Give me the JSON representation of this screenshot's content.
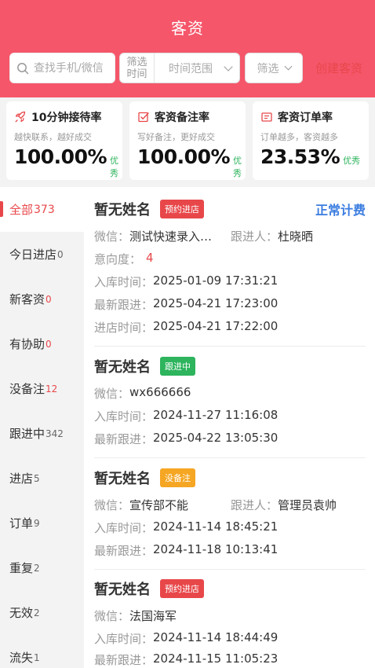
{
  "header": {
    "title": "客资"
  },
  "search": {
    "placeholder": "查找手机/微信"
  },
  "time_filter": {
    "label_line1": "筛选",
    "label_line2": "时间",
    "value": "时间范围"
  },
  "filter": {
    "label": "筛选"
  },
  "create": {
    "label": "创建客资"
  },
  "stats": [
    {
      "title": "10分钟接待率",
      "sub": "越快联系，越好成交",
      "value": "100.00%",
      "badge": "优秀",
      "icon": "rocket-icon"
    },
    {
      "title": "客资备注率",
      "sub": "写好备注，更好成交",
      "value": "100.00%",
      "badge": "优秀",
      "icon": "checkbox-icon"
    },
    {
      "title": "客资订单率",
      "sub": "订单越多，客资越多",
      "value": "23.53%",
      "badge": "优秀",
      "icon": "order-icon"
    }
  ],
  "sidebar": [
    {
      "label": "全部",
      "count": "373"
    },
    {
      "label": "今日进店",
      "count": "0"
    },
    {
      "label": "新客资",
      "count": "0"
    },
    {
      "label": "有协助",
      "count": "0"
    },
    {
      "label": "没备注",
      "count": "12"
    },
    {
      "label": "跟进中",
      "count": "342"
    },
    {
      "label": "进店",
      "count": "5"
    },
    {
      "label": "订单",
      "count": "9"
    },
    {
      "label": "重复",
      "count": "2"
    },
    {
      "label": "无效",
      "count": "2"
    },
    {
      "label": "流失",
      "count": "1"
    }
  ],
  "cards": [
    {
      "name": "暂无姓名",
      "tag": "预约进店",
      "tag_color": "#e8474a",
      "billing": "正常计费",
      "wechat_label": "微信：",
      "wechat": "测试快速录入…",
      "follower_label": "跟进人：",
      "follower": "杜晓晒",
      "intent_label": "意向度：",
      "intent": "4",
      "in_label": "入库时间：",
      "in_time": "2025-01-09 17:31:21",
      "latest_label": "最新跟进：",
      "latest_time": "2025-04-21 17:23:00",
      "store_label": "进店时间：",
      "store_time": "2025-04-21 17:22:00"
    },
    {
      "name": "暂无姓名",
      "tag": "跟进中",
      "tag_color": "#2db45d",
      "wechat_label": "微信：",
      "wechat": "wx666666",
      "in_label": "入库时间：",
      "in_time": "2024-11-27 11:16:08",
      "latest_label": "最新跟进：",
      "latest_time": "2025-04-22 13:05:30"
    },
    {
      "name": "暂无姓名",
      "tag": "没备注",
      "tag_color": "#f5a623",
      "wechat_label": "微信：",
      "wechat": "宣传部不能",
      "follower_label": "跟进人：",
      "follower": "管理员袁帅",
      "in_label": "入库时间：",
      "in_time": "2024-11-14 18:45:21",
      "latest_label": "最新跟进：",
      "latest_time": "2024-11-18 10:13:41"
    },
    {
      "name": "暂无姓名",
      "tag": "预约进店",
      "tag_color": "#e8474a",
      "wechat_label": "微信：",
      "wechat": "法国海军",
      "in_label": "入库时间：",
      "in_time": "2024-11-14 18:44:49",
      "latest_label": "最新跟进：",
      "latest_time": "2024-11-15 11:05:23"
    }
  ]
}
